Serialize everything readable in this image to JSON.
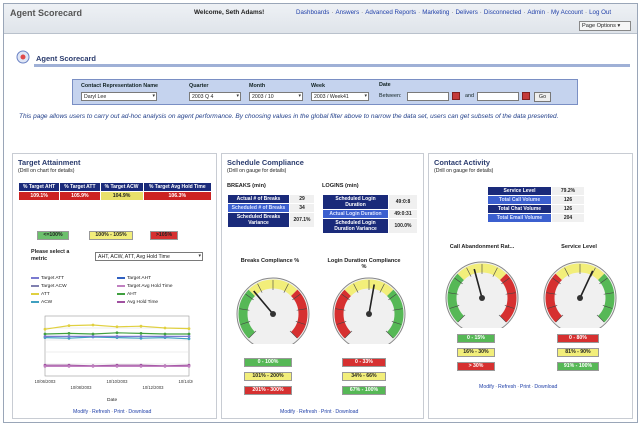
{
  "app": {
    "title": "Agent Scorecard"
  },
  "topbar": {
    "welcome": "Welcome, Seth Adams!",
    "links": [
      "Dashboards",
      "Answers",
      "Advanced Reports",
      "Marketing",
      "Delivers",
      "Disconnected",
      "Admin",
      "My Account",
      "Log Out"
    ],
    "page_options": "Page Options"
  },
  "header": {
    "title": "Agent Scorecard"
  },
  "filters": {
    "rep_label": "Contact Representation Name",
    "rep_value": "Daryl Lee",
    "quarter_label": "Quarter",
    "quarter_value": "2003 Q 4",
    "month_label": "Month",
    "month_value": "2003 / 10",
    "week_label": "Week",
    "week_value": "2003 / Week41",
    "date_label": "Date",
    "between_label": "Between:",
    "and_label": "and",
    "go_label": "Go"
  },
  "description": "This page allows users to carry out ad-hoc analysis on agent performance. By choosing values in the global filter above to narrow the data set, users can get subsets of the data presented.",
  "target": {
    "title": "Target Attainment",
    "subtitle": "(Drill on chart for details)",
    "headers": [
      "% Target AHT",
      "% Target ATT",
      "% Target ACW",
      "% Target Avg Hold Time"
    ],
    "values": [
      "109.1%",
      "105.9%",
      "104.9%",
      "106.3%"
    ],
    "value_colors": [
      "#cc2222",
      "#cc2222",
      "#e8e06a",
      "#cc2222"
    ],
    "legend": [
      {
        "label": "<=100%",
        "color": "#6cc06c"
      },
      {
        "label": "100% - 105%",
        "color": "#f2ee7a"
      },
      {
        "label": ">105%",
        "color": "#d63030"
      }
    ],
    "metric_label": "Please select a metric",
    "metric_value": "AHT, ACW, ATT, Avg Hold Time",
    "series_legend": [
      {
        "name": "Target ATT",
        "color": "#7a7ad0"
      },
      {
        "name": "Target AHT",
        "color": "#3060c0"
      },
      {
        "name": "Target ACW",
        "color": "#8080b0"
      },
      {
        "name": "Target Avg Hold Time",
        "color": "#c080c0"
      },
      {
        "name": "ATT",
        "color": "#e0d040"
      },
      {
        "name": "AHT",
        "color": "#40a040"
      },
      {
        "name": "ACW",
        "color": "#40a0c0"
      },
      {
        "name": "Avg Hold Time",
        "color": "#a050a0"
      }
    ],
    "x_ticks": [
      "10/06/2003",
      "10/08/2003",
      "10/10/2003",
      "10/12/2003",
      "10/14/2003"
    ],
    "x_label": "Date",
    "footer": [
      "Modify",
      "Refresh",
      "Print",
      "Download"
    ]
  },
  "chart_data": {
    "type": "line",
    "x": [
      "10/06/2003",
      "10/07/2003",
      "10/08/2003",
      "10/09/2003",
      "10/10/2003",
      "10/13/2003",
      "10/14/2003"
    ],
    "ylim": [
      0,
      100
    ],
    "xlabel": "Date",
    "series": [
      {
        "name": "ATT",
        "values": [
          78,
          84,
          85,
          82,
          83,
          80,
          79
        ]
      },
      {
        "name": "AHT",
        "values": [
          70,
          71,
          70,
          72,
          71,
          70,
          70
        ]
      },
      {
        "name": "ACW",
        "values": [
          64,
          63,
          65,
          64,
          63,
          64,
          62
        ]
      },
      {
        "name": "Target ATT",
        "values": [
          66,
          66,
          66,
          66,
          66,
          66,
          66
        ]
      },
      {
        "name": "Avg Hold Time",
        "values": [
          18,
          18,
          17,
          18,
          18,
          17,
          18
        ]
      },
      {
        "name": "Target Avg Hold Time",
        "values": [
          16,
          16,
          16,
          16,
          16,
          16,
          16
        ]
      }
    ]
  },
  "schedule": {
    "title": "Schedule Compliance",
    "subtitle": "(Drill on gauge for details)",
    "breaks_heading": "BREAKS (min)",
    "logins_heading": "LOGINS (min)",
    "breaks_rows": [
      {
        "label": "Actual # of Breaks",
        "value": "29",
        "alt": false
      },
      {
        "label": "Scheduled # of Breaks",
        "value": "34",
        "alt": true
      },
      {
        "label": "Scheduled Breaks Variance",
        "value": "207.1%",
        "alt": false
      }
    ],
    "logins_rows": [
      {
        "label": "Scheduled Login Duration",
        "value": "49:0:8",
        "alt": false
      },
      {
        "label": "Actual Login Duration",
        "value": "49:0:31",
        "alt": true
      },
      {
        "label": "Scheduled Login Duration Variance",
        "value": "100.0%",
        "alt": false
      }
    ],
    "gauge1_label": "Breaks Compliance %",
    "gauge2_label": "Login Duration Compliance %",
    "gauge1_ranges": [
      {
        "label": "0 - 100%",
        "color": "#56b856"
      },
      {
        "label": "101% - 200%",
        "color": "#f2ee7a"
      },
      {
        "label": "201% - 300%",
        "color": "#d63030"
      }
    ],
    "gauge2_ranges": [
      {
        "label": "0 - 33%",
        "color": "#d63030"
      },
      {
        "label": "34% - 66%",
        "color": "#f2ee7a"
      },
      {
        "label": "67% - 100%",
        "color": "#56b856"
      }
    ],
    "footer": [
      "Modify",
      "Refresh",
      "Print",
      "Download"
    ]
  },
  "contact": {
    "title": "Contact Activity",
    "subtitle": "(Drill on gauge for details)",
    "rows": [
      {
        "label": "Service Level",
        "value": "79.2%",
        "alt": false
      },
      {
        "label": "Total Call Volume",
        "value": "126",
        "alt": true
      },
      {
        "label": "Total Chat Volume",
        "value": "126",
        "alt": false
      },
      {
        "label": "Total Email Volume",
        "value": "204",
        "alt": true
      }
    ],
    "gauge1_label": "Call Abandonment Rat...",
    "gauge2_label": "Service Level",
    "gauge1_ranges": [
      {
        "label": "0 - 15%",
        "color": "#56b856"
      },
      {
        "label": "16% - 30%",
        "color": "#f2ee7a"
      },
      {
        "label": "> 30%",
        "color": "#d63030"
      }
    ],
    "gauge2_ranges": [
      {
        "label": "0 - 80%",
        "color": "#d63030"
      },
      {
        "label": "81% - 90%",
        "color": "#f2ee7a"
      },
      {
        "label": "91% - 100%",
        "color": "#56b856"
      }
    ],
    "footer": [
      "Modify",
      "Refresh",
      "Print",
      "Download"
    ]
  },
  "colors": {
    "nav_blue": "#1a2a7a",
    "link": "#1f3fa8",
    "title": "#2b3c6e"
  }
}
